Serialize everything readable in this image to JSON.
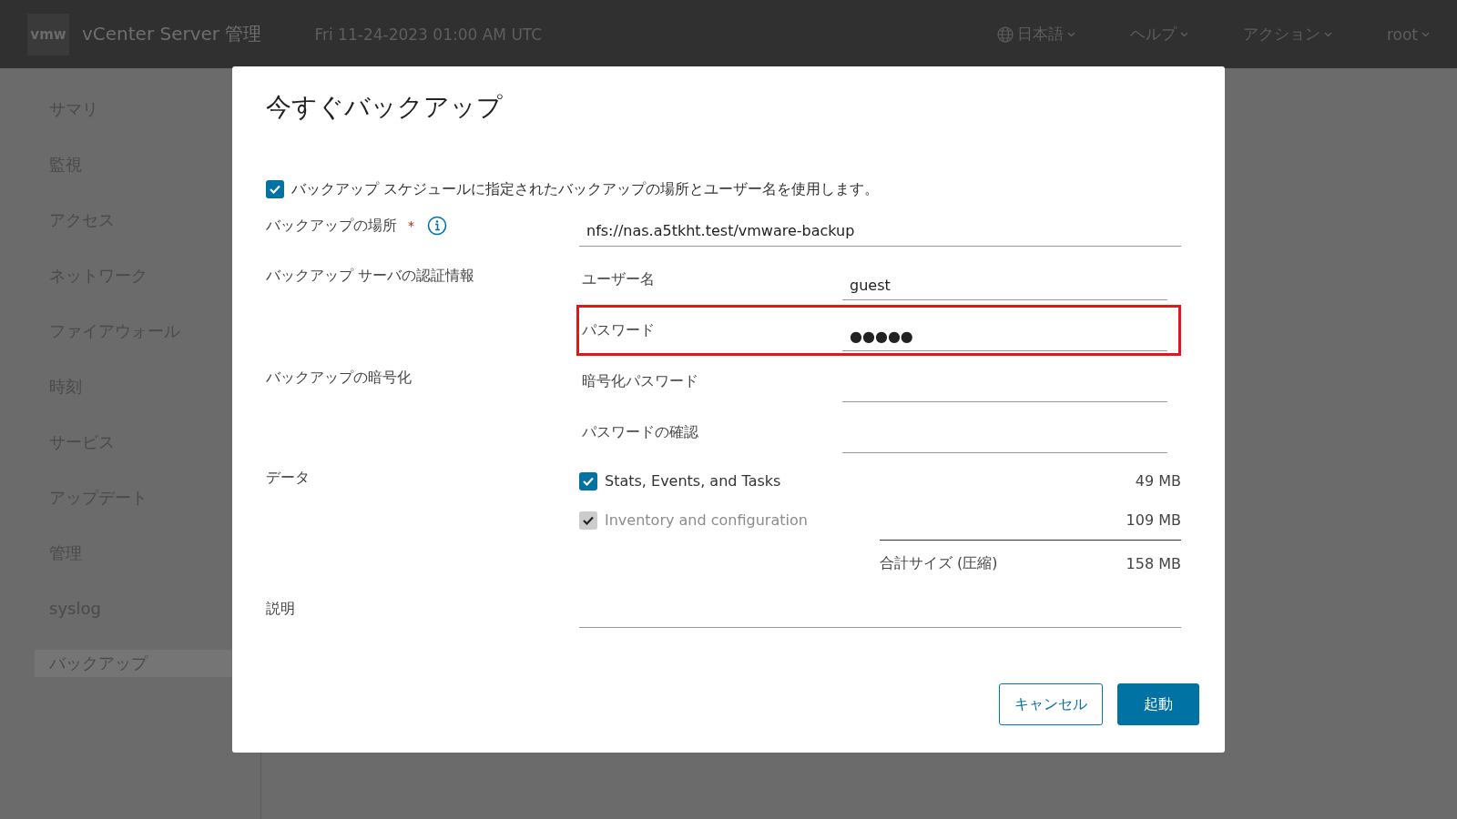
{
  "header": {
    "logo": "vmw",
    "title": "vCenter Server 管理",
    "datetime": "Fri 11-24-2023 01:00 AM UTC",
    "menus": [
      {
        "label": "日本語",
        "kind": "language"
      },
      {
        "label": "ヘルプ",
        "kind": "plain"
      },
      {
        "label": "アクション",
        "kind": "plain"
      },
      {
        "label": "root",
        "kind": "plain"
      }
    ]
  },
  "sidebar": {
    "items": [
      {
        "label": "サマリ",
        "selected": false
      },
      {
        "label": "監視",
        "selected": false
      },
      {
        "label": "アクセス",
        "selected": false
      },
      {
        "label": "ネットワーク",
        "selected": false
      },
      {
        "label": "ファイアウォール",
        "selected": false
      },
      {
        "label": "時刻",
        "selected": false
      },
      {
        "label": "サービス",
        "selected": false
      },
      {
        "label": "アップデート",
        "selected": false
      },
      {
        "label": "管理",
        "selected": false
      },
      {
        "label": "syslog",
        "selected": false
      },
      {
        "label": "バックアップ",
        "selected": true
      }
    ]
  },
  "dialog": {
    "title": "今すぐバックアップ",
    "use_schedule": {
      "label": "バックアップ スケジュールに指定されたバックアップの場所とユーザー名を使用します。",
      "checked": true
    },
    "location": {
      "label": "バックアップの場所",
      "required_mark": "*",
      "value": "nfs://nas.a5tkht.test/vmware-backup"
    },
    "credentials": {
      "label": "バックアップ サーバの認証情報",
      "fields": [
        {
          "label": "ユーザー名",
          "value": "guest",
          "highlighted": false
        },
        {
          "label": "パスワード",
          "value": "●●●●●",
          "highlighted": true
        }
      ]
    },
    "encryption": {
      "label": "バックアップの暗号化",
      "fields": [
        {
          "label": "暗号化パスワード",
          "highlighted": false
        },
        {
          "label": "パスワードの確認",
          "highlighted": false
        }
      ]
    },
    "data": {
      "label": "データ",
      "items": [
        {
          "label": "Stats, Events, and Tasks",
          "size": "49 MB",
          "checked": true,
          "disabled": false
        },
        {
          "label": "Inventory and configuration",
          "size": "109 MB",
          "checked": true,
          "disabled": true
        }
      ],
      "total": {
        "label": "合計サイズ (圧縮)",
        "size": "158 MB"
      }
    },
    "description": {
      "label": "説明"
    },
    "buttons": [
      {
        "label": "キャンセル",
        "kind": "secondary"
      },
      {
        "label": "起動",
        "kind": "primary"
      }
    ]
  }
}
